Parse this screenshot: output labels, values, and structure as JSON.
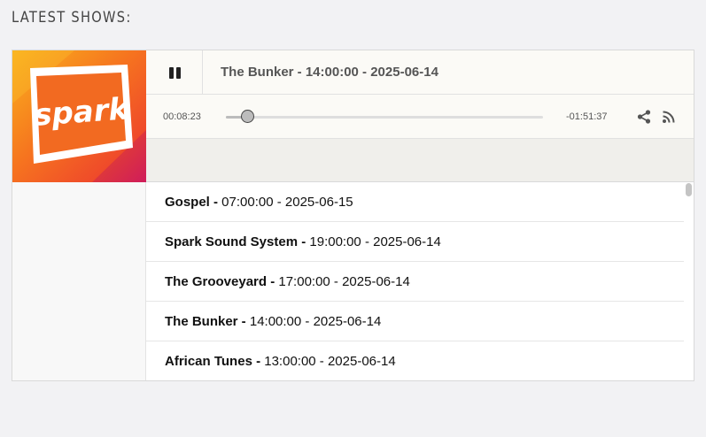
{
  "section": {
    "heading": "LATEST SHOWS:"
  },
  "artwork": {
    "logo_text": "spark"
  },
  "player": {
    "now_playing": "The Bunker - 14:00:00 - 2025-06-14",
    "elapsed": "00:08:23",
    "remaining": "-01:51:37",
    "progress_percent": 7,
    "state": "playing"
  },
  "shows": [
    {
      "name": "Gospel -",
      "time": " 07:00:00 - 2025-06-15"
    },
    {
      "name": "Spark Sound System -",
      "time": " 19:00:00 - 2025-06-14"
    },
    {
      "name": "The Grooveyard -",
      "time": " 17:00:00 - 2025-06-14"
    },
    {
      "name": "The Bunker -",
      "time": " 14:00:00 - 2025-06-14"
    },
    {
      "name": "African Tunes -",
      "time": " 13:00:00 - 2025-06-14"
    }
  ],
  "colors": {
    "brand_orange": "#f26522",
    "brand_pink": "#d11f5e",
    "brand_yellow": "#f7a21b"
  },
  "icons": {
    "pause": "pause-icon",
    "share": "share-icon",
    "rss": "rss-icon"
  }
}
